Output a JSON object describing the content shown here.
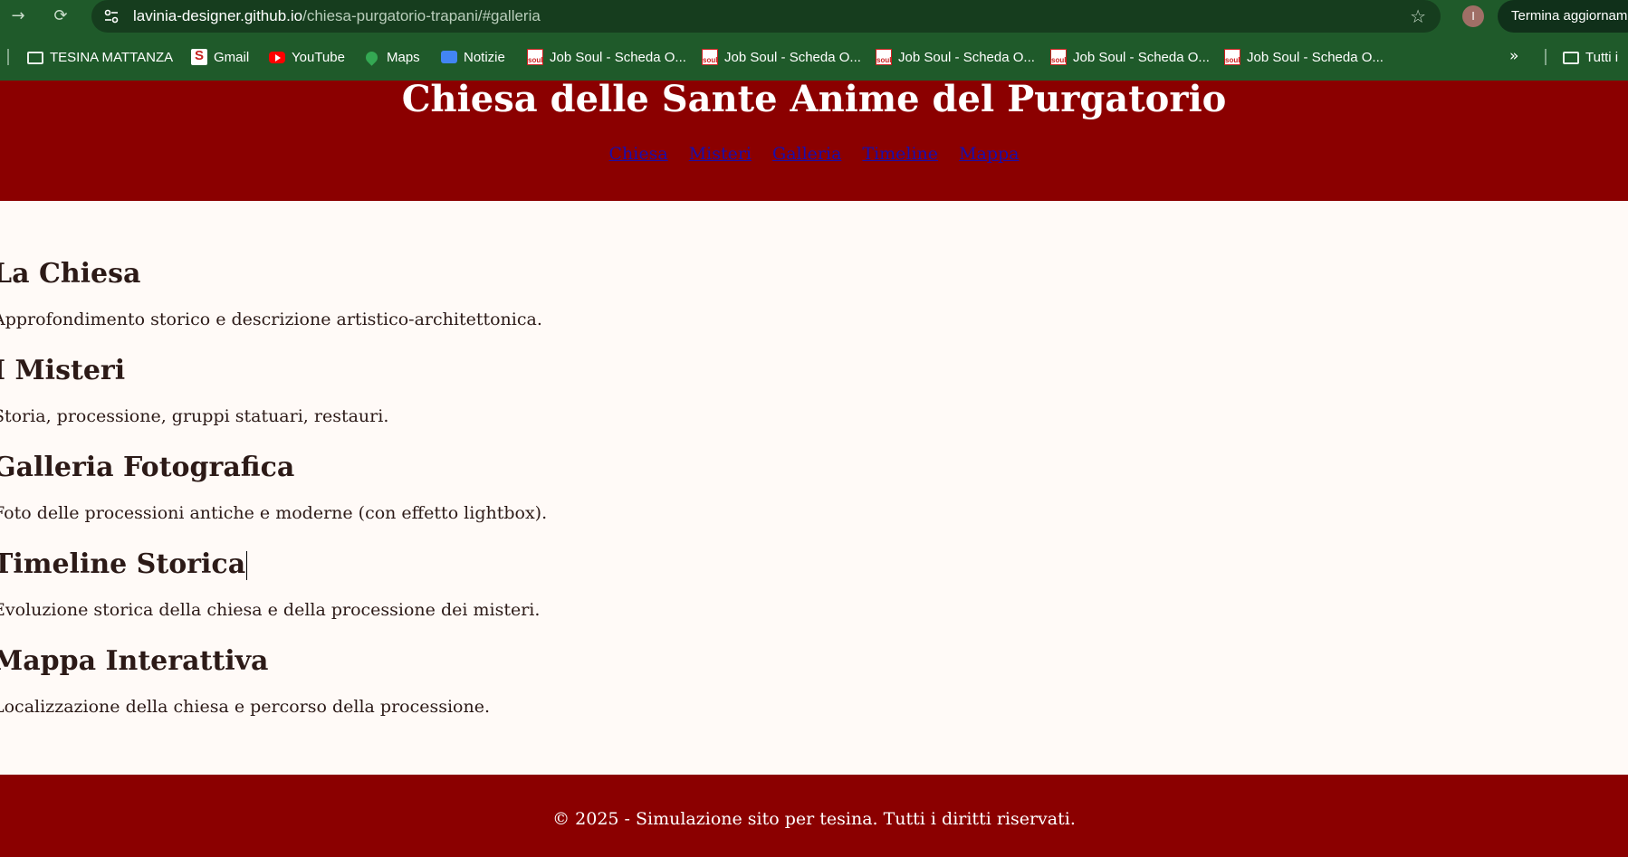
{
  "browser": {
    "url_host": "lavinia-designer.github.io",
    "url_path": "/chiesa-purgatorio-trapani/#galleria",
    "profile_initial": "I",
    "update_button": "Termina aggiornam",
    "bookmarks": [
      {
        "label": "TESINA MATTANZA",
        "icon": "folder-icon"
      },
      {
        "label": "Gmail",
        "icon": "gmail-icon"
      },
      {
        "label": "YouTube",
        "icon": "youtube-icon"
      },
      {
        "label": "Maps",
        "icon": "maps-icon"
      },
      {
        "label": "Notizie",
        "icon": "news-icon"
      },
      {
        "label": "Job Soul - Scheda O...",
        "icon": "soul-icon"
      },
      {
        "label": "Job Soul - Scheda O...",
        "icon": "soul-icon"
      },
      {
        "label": "Job Soul - Scheda O...",
        "icon": "soul-icon"
      },
      {
        "label": "Job Soul - Scheda O...",
        "icon": "soul-icon"
      },
      {
        "label": "Job Soul - Scheda O...",
        "icon": "soul-icon"
      }
    ],
    "more_bookmarks": "»",
    "all_bookmarks": "Tutti i"
  },
  "header": {
    "title": "Chiesa delle Sante Anime del Purgatorio",
    "nav": [
      "Chiesa",
      "Misteri",
      "Galleria",
      "Timeline",
      "Mappa"
    ]
  },
  "sections": [
    {
      "heading": "La Chiesa",
      "text": "Approfondimento storico e descrizione artistico-architettonica."
    },
    {
      "heading": "I Misteri",
      "text": "Storia, processione, gruppi statuari, restauri."
    },
    {
      "heading": "Galleria Fotografica",
      "text": "Foto delle processioni antiche e moderne (con effetto lightbox)."
    },
    {
      "heading": "Timeline Storica",
      "text": "Evoluzione storica della chiesa e della processione dei misteri."
    },
    {
      "heading": "Mappa Interattiva",
      "text": "Localizzazione della chiesa e percorso della processione."
    }
  ],
  "footer": {
    "text": "© 2025 - Simulazione sito per tesina. Tutti i diritti riservati."
  },
  "colors": {
    "header_bg": "#8b0000",
    "page_bg": "#fffaf7",
    "chrome_bg": "#1f5a2a",
    "link": "#1a0dab"
  }
}
